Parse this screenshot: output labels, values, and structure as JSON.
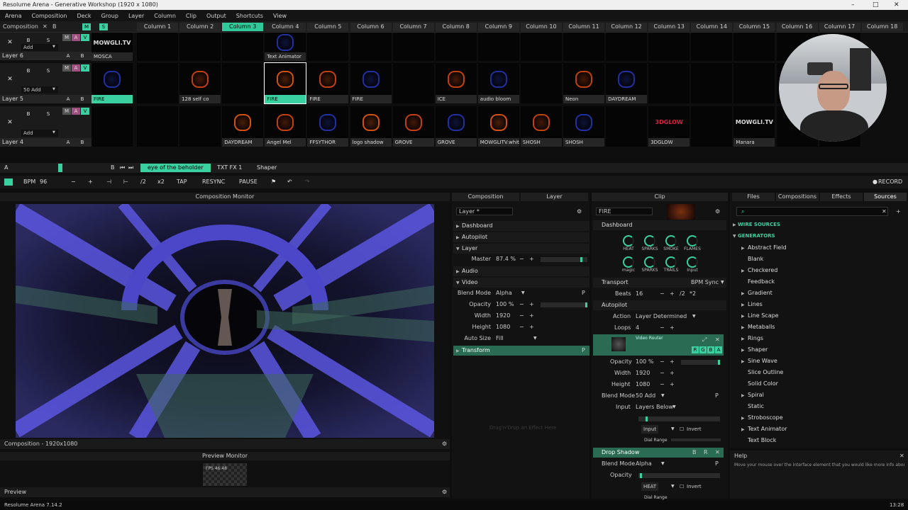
{
  "window": {
    "title": "Resolume Arena - Generative Workshop (1920 x 1080)",
    "min": "–",
    "max": "□",
    "close": "✕"
  },
  "menu": [
    "Arena",
    "Composition",
    "Deck",
    "Group",
    "Layer",
    "Column",
    "Clip",
    "Output",
    "Shortcuts",
    "View"
  ],
  "composition_label": "Composition",
  "columns": [
    "Column 1",
    "Column 2",
    "Column 3",
    "Column 4",
    "Column 5",
    "Column 6",
    "Column 7",
    "Column 8",
    "Column 9",
    "Column 10",
    "Column 11",
    "Column 12",
    "Column 13",
    "Column 14",
    "Column 15",
    "Column 16",
    "Column 17",
    "Column 18"
  ],
  "active_column_index": 2,
  "layers": [
    {
      "name": "Layer 6",
      "add": "Add",
      "clips": [
        "MOSCA",
        "",
        "",
        "",
        "Text Animator",
        "",
        "",
        "",
        "",
        "",
        "",
        "",
        "",
        "",
        "",
        "",
        "",
        ""
      ],
      "art": [
        "MOWGLI.TV",
        "",
        "",
        "",
        "",
        "",
        "",
        "",
        "",
        "",
        "",
        "",
        "",
        "",
        "",
        "",
        "",
        ""
      ]
    },
    {
      "name": "Layer 5",
      "add": "50 Add",
      "clips": [
        "FIRE",
        "",
        "128 self co",
        "",
        "FIRE",
        "FIRE",
        "FIRE",
        "",
        "ICE",
        "audio bloom",
        "",
        "Neon",
        "DAYDREAM",
        "",
        "",
        "",
        "",
        ""
      ],
      "art": [
        "",
        "",
        "",
        "",
        "",
        "",
        "",
        "",
        "",
        "",
        "",
        "",
        "",
        "",
        "",
        "",
        "",
        ""
      ]
    },
    {
      "name": "Layer 4",
      "add": "Add",
      "clips": [
        "",
        "",
        "",
        "DAYDREAM",
        "Angel Mel",
        "FFSYTHOR",
        "logo shadow",
        "GROVE",
        "GROVE",
        "MOWGLITV.white",
        "SHOSH",
        "SHOSH",
        "",
        "3DGLOW",
        "",
        "Manara",
        "",
        ""
      ],
      "art": [
        "",
        "",
        "",
        "",
        "",
        "",
        "",
        "",
        "",
        "",
        "",
        "",
        "",
        "3DGLOW",
        "",
        "MOWGLI.TV",
        "",
        ""
      ]
    }
  ],
  "layer_buttons": {
    "b": "B",
    "s": "S",
    "x": "✕",
    "m": "M",
    "a": "A",
    "v": "V"
  },
  "deck": {
    "a": "A",
    "b": "B",
    "tabs": [
      "eye of the beholder",
      "TXT FX 1",
      "Shaper"
    ],
    "active_tab": 0
  },
  "transport": {
    "bpm_label": "BPM",
    "bpm": "96",
    "minus": "−",
    "plus": "+",
    "half": "/2",
    "double": "x2",
    "tap": "TAP",
    "resync": "RESYNC",
    "pause": "PAUSE",
    "record": "RECORD"
  },
  "monitor": {
    "title": "Composition Monitor",
    "footer": "Composition - 1920x1080",
    "preview_title": "Preview Monitor",
    "preview_text": "FPS 46.48",
    "preview_footer": "Preview"
  },
  "comp_layer_panel": {
    "tabs": [
      "Composition",
      "Layer"
    ],
    "search": "Layer *",
    "rows": [
      {
        "label": "Dashboard"
      },
      {
        "label": "Autopilot"
      },
      {
        "label": "Layer"
      },
      {
        "label": "Master",
        "value": "87.4 %"
      },
      {
        "label": "Audio"
      },
      {
        "label": "Video"
      },
      {
        "label": "Blend Mode",
        "value": "Alpha"
      },
      {
        "label": "Opacity",
        "value": "100 %"
      },
      {
        "label": "Width",
        "value": "1920"
      },
      {
        "label": "Height",
        "value": "1080"
      },
      {
        "label": "Auto Size",
        "value": "Fill"
      },
      {
        "label": "Transform"
      }
    ],
    "hint": "Drag'n'Drop an Effect Here"
  },
  "clip_panel": {
    "title": "Clip",
    "search": "FIRE",
    "dashboard": "Dashboard",
    "knobs": [
      "HEAT",
      "SPARKS",
      "SMOKE",
      "FLAMES",
      "magic",
      "SPARKS",
      "TRAILS",
      "Input"
    ],
    "transport": "Transport",
    "sync": "BPM Sync",
    "beats_label": "Beats",
    "beats": "16",
    "half": "/2",
    "double": "*2",
    "autopilot": "Autopilot",
    "action_label": "Action",
    "action": "Layer Determined",
    "loops_label": "Loops",
    "loops": "4",
    "video_router": "Video Router",
    "rgba": [
      "R",
      "G",
      "B",
      "A"
    ],
    "opacity_label": "Opacity",
    "opacity": "100 %",
    "width_label": "Width",
    "width": "1920",
    "height_label": "Height",
    "height": "1080",
    "blend_label": "Blend Mode",
    "blend": "50 Add",
    "input_label": "Input",
    "input": "Layers Below",
    "input2": "Input",
    "invert": "Invert",
    "dial_range": "Dial Range",
    "drop_shadow": "Drop Shadow",
    "ds_blend": "Alpha",
    "ds_opacity_label": "Opacity",
    "heat": "HEAT"
  },
  "sources_panel": {
    "tabs": [
      "Files",
      "Compositions",
      "Effects",
      "Sources"
    ],
    "active_tab": 3,
    "wire_sources": "WIRE SOURCES",
    "generators": "GENERATORS",
    "items": [
      "Abstract Field",
      "Blank",
      "Checkered",
      "Feedback",
      "Gradient",
      "Lines",
      "Line Scape",
      "Metaballs",
      "Rings",
      "Shaper",
      "Sine Wave",
      "Slice Outline",
      "Solid Color",
      "Spiral",
      "Static",
      "Stroboscope",
      "Text Animator",
      "Text Block"
    ],
    "expandable": [
      true,
      false,
      true,
      false,
      true,
      true,
      true,
      true,
      true,
      true,
      true,
      false,
      false,
      true,
      false,
      true,
      true,
      false
    ]
  },
  "help": {
    "title": "Help",
    "text": "Move your mouse over the interface element that you would like more info about."
  },
  "status": {
    "version": "Resolume Arena 7.14.2",
    "time": "13:28"
  },
  "colors": {
    "accent": "#3ad0a0",
    "bg": "#0e0e0e",
    "panel": "#1c1c1c"
  }
}
